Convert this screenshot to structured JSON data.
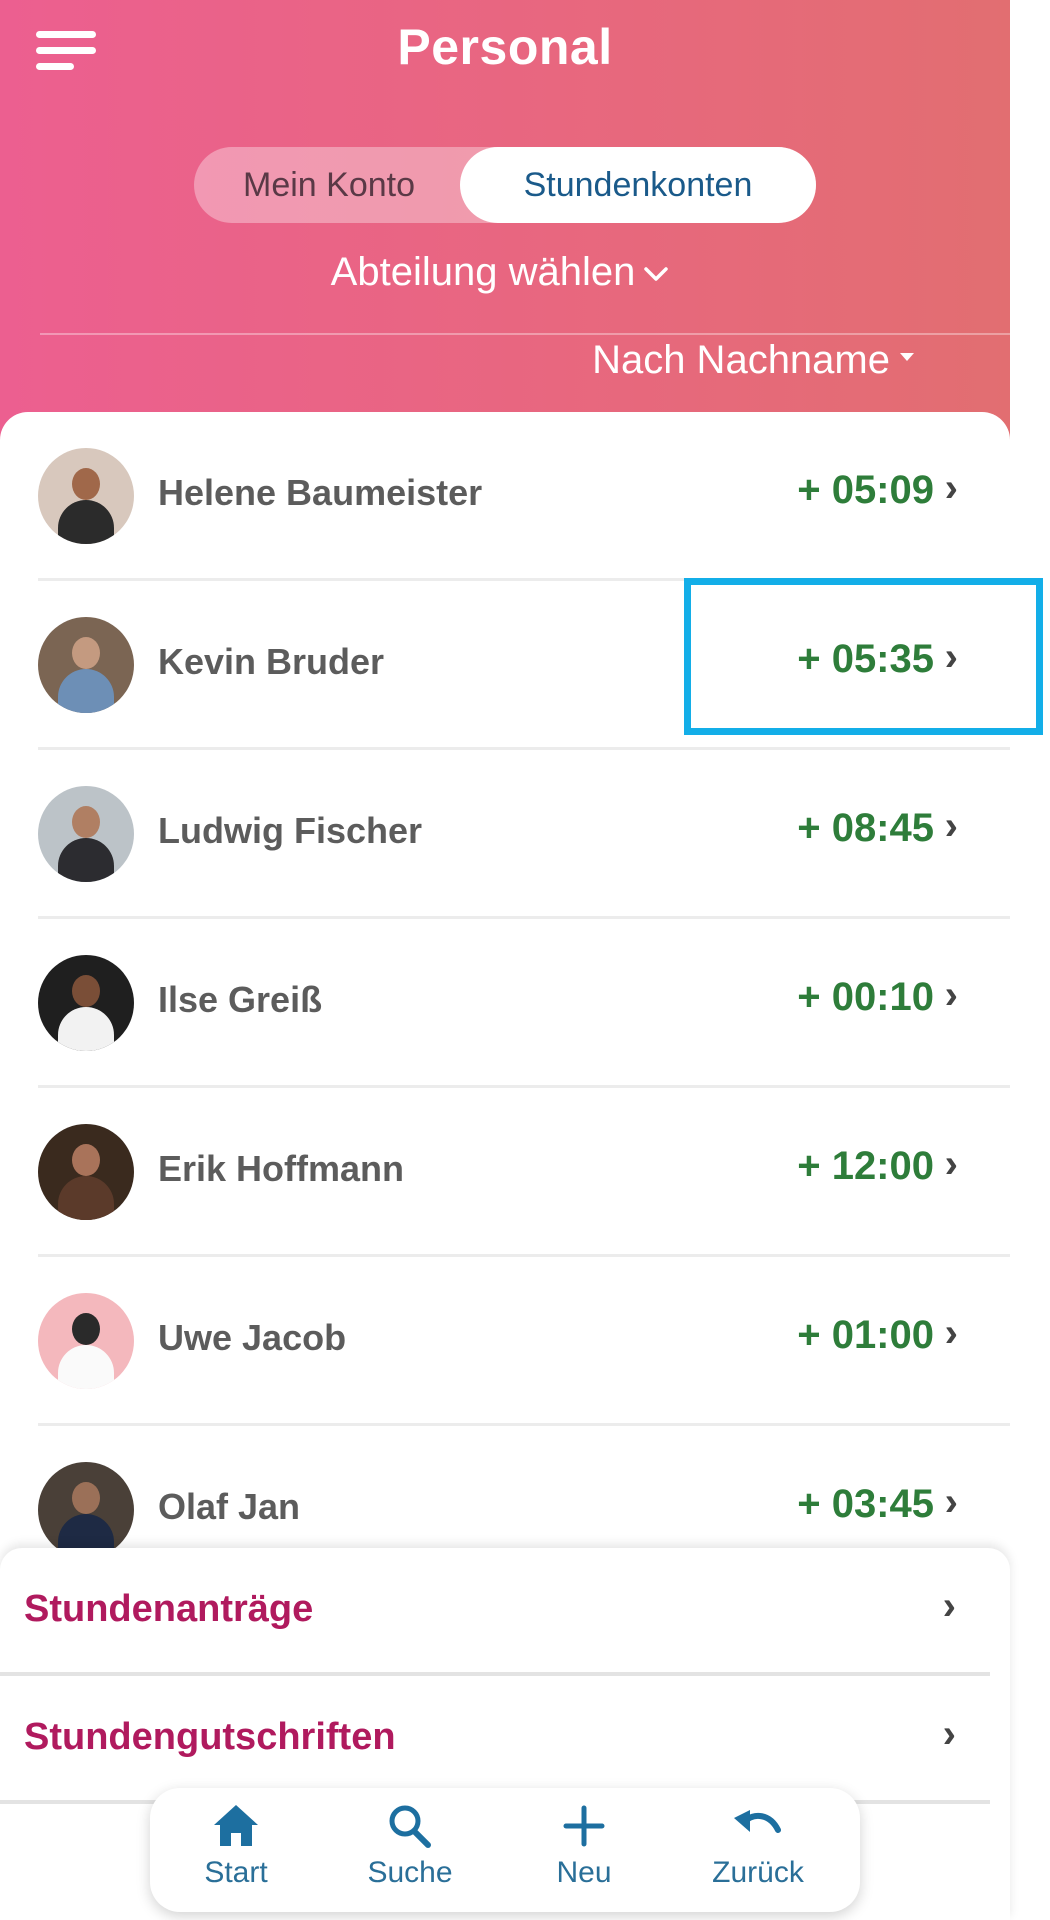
{
  "header": {
    "title": "Personal",
    "tabs": [
      {
        "label": "Mein Konto",
        "selected": false
      },
      {
        "label": "Stundenkonten",
        "selected": true
      }
    ],
    "department_label": "Abteilung wählen",
    "sort_label": "Nach Nachname"
  },
  "employees": [
    {
      "name": "Helene Baumeister",
      "balance": "+ 05:09"
    },
    {
      "name": "Kevin Bruder",
      "balance": "+ 05:35"
    },
    {
      "name": "Ludwig Fischer",
      "balance": "+ 08:45"
    },
    {
      "name": "Ilse Greiß",
      "balance": "+ 00:10"
    },
    {
      "name": "Erik Hoffmann",
      "balance": "+ 12:00"
    },
    {
      "name": "Uwe Jacob",
      "balance": "+ 01:00"
    },
    {
      "name": "Olaf Jan",
      "balance": "+ 03:45"
    }
  ],
  "sheet": {
    "items": [
      {
        "label": "Stundenanträge"
      },
      {
        "label": "Stundengutschriften"
      }
    ]
  },
  "nav": {
    "items": [
      {
        "label": "Start",
        "icon": "home-icon"
      },
      {
        "label": "Suche",
        "icon": "search-icon"
      },
      {
        "label": "Neu",
        "icon": "plus-icon"
      },
      {
        "label": "Zurück",
        "icon": "undo-icon"
      }
    ]
  },
  "colors": {
    "header_gradient_start": "#ec5f90",
    "header_gradient_end": "#e26e71",
    "balance_green": "#2e7d3a",
    "sheet_label": "#b01a5e",
    "nav_blue": "#2a6f98",
    "highlight": "#13aee8"
  }
}
